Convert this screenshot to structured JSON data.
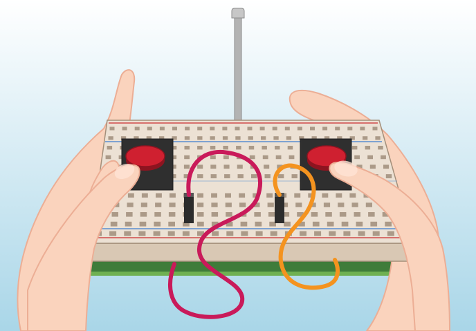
{
  "scene": {
    "subject": "handheld-breadboard-remote-control",
    "colors": {
      "sky_top": "#ffffff",
      "sky_bottom": "#a9d6e8",
      "skin": "#fad3bd",
      "skin_shadow": "#ecae95",
      "board_top": "#ece1d4",
      "board_side": "#d9c8b4",
      "board_edge": "#a48f7a",
      "hole": "#ab9a88",
      "rail_red": "#d04a4a",
      "rail_blue": "#5a8ed0",
      "pcb": "#3f7c3a",
      "pcb_light": "#6fb052",
      "button_base": "#2f2f2f",
      "button_cap": "#cf2030",
      "wire_magenta": "#c91a5a",
      "wire_orange": "#f4931f",
      "antenna": "#b3b3b3"
    },
    "icons": [
      "left-hand",
      "right-hand",
      "breadboard",
      "push-button-left",
      "push-button-right",
      "antenna",
      "header-pin-left",
      "header-pin-right",
      "magenta-wire",
      "orange-wire"
    ]
  }
}
